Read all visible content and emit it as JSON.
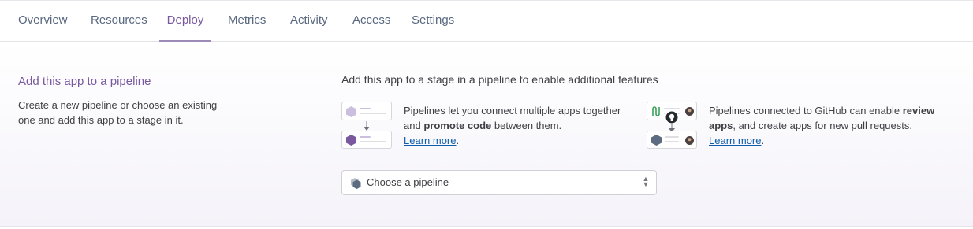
{
  "tabs": [
    {
      "label": "Overview"
    },
    {
      "label": "Resources"
    },
    {
      "label": "Deploy"
    },
    {
      "label": "Metrics"
    },
    {
      "label": "Activity"
    },
    {
      "label": "Access"
    },
    {
      "label": "Settings"
    }
  ],
  "active_tab": "Deploy",
  "pipeline_section": {
    "title": "Add this app to a pipeline",
    "description": "Create a new pipeline or choose an existing one and add this app to a stage in it.",
    "heading": "Add this app to a stage in a pipeline to enable additional features",
    "feature_pipelines": {
      "text_before": "Pipelines let you connect multiple apps together and ",
      "bold": "promote code",
      "text_after": " between them.",
      "link": "Learn more",
      "link_suffix": "."
    },
    "feature_github": {
      "text_before": "Pipelines connected to GitHub can enable ",
      "bold": "review apps",
      "text_after": ", and create apps for new pull requests.",
      "link": "Learn more",
      "link_suffix": "."
    },
    "select": {
      "value": "Choose a pipeline",
      "icon": "pipeline-hexagon-icon"
    }
  },
  "colors": {
    "accent": "#79589f",
    "link": "#0f5ca8",
    "tab_text": "#596981"
  }
}
